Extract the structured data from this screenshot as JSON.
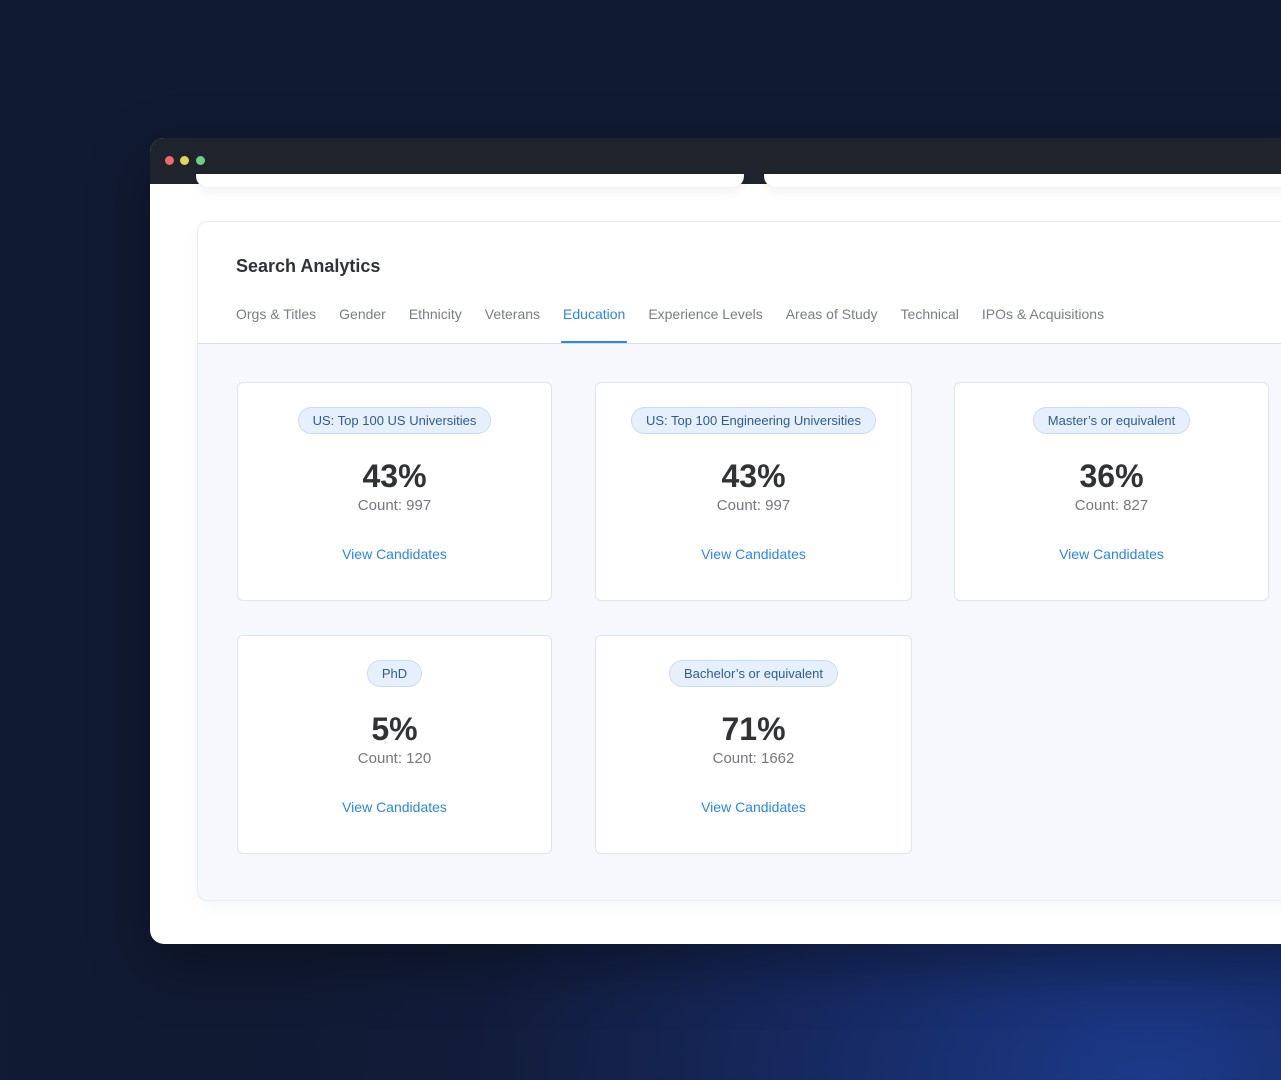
{
  "window": {
    "controls": [
      "close",
      "minimize",
      "maximize"
    ]
  },
  "panel": {
    "title": "Search Analytics",
    "tabs": [
      {
        "label": "Orgs & Titles",
        "active": false
      },
      {
        "label": "Gender",
        "active": false
      },
      {
        "label": "Ethnicity",
        "active": false
      },
      {
        "label": "Veterans",
        "active": false
      },
      {
        "label": "Education",
        "active": true
      },
      {
        "label": "Experience Levels",
        "active": false
      },
      {
        "label": "Areas of Study",
        "active": false
      },
      {
        "label": "Technical",
        "active": false
      },
      {
        "label": "IPOs & Acquisitions",
        "active": false
      }
    ],
    "cards": [
      {
        "tag": "US: Top 100 US Universities",
        "percent": "43%",
        "count": "Count: 997",
        "link": "View Candidates"
      },
      {
        "tag": "US: Top 100 Engineering Universities",
        "percent": "43%",
        "count": "Count: 997",
        "link": "View Candidates"
      },
      {
        "tag": "Master’s or equivalent",
        "percent": "36%",
        "count": "Count: 827",
        "link": "View Candidates"
      },
      {
        "tag": "PhD",
        "percent": "5%",
        "count": "Count: 120",
        "link": "View Candidates"
      },
      {
        "tag": "Bachelor’s or equivalent",
        "percent": "71%",
        "count": "Count: 1662",
        "link": "View Candidates"
      }
    ]
  },
  "colors": {
    "accent": "#2a86f0",
    "pill_bg": "#e6f0fc",
    "pill_text": "#2e5c94",
    "titlebar": "#1f232b"
  }
}
